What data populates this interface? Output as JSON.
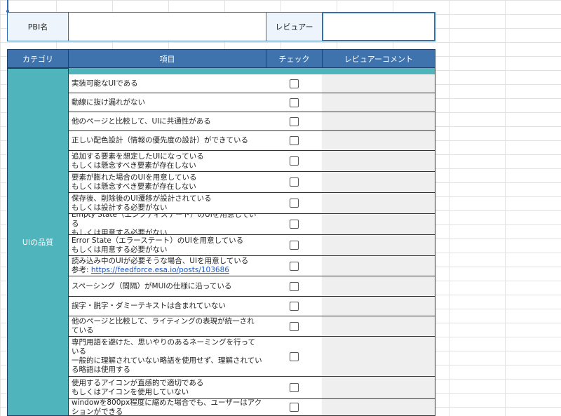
{
  "header": {
    "pbi_label": "PBI名",
    "pbi_value": "",
    "reviewer_label": "レビュアー",
    "reviewer_value": ""
  },
  "columns": {
    "category": "カテゴリ",
    "item": "項目",
    "check": "チェック",
    "comment": "レビュアーコメント"
  },
  "category_label": "UIの品質",
  "rows": [
    {
      "line1": "実装可能なUIである",
      "line2": ""
    },
    {
      "line1": "動線に抜け漏れがない",
      "line2": ""
    },
    {
      "line1": "他のページと比較して、UIに共通性がある",
      "line2": ""
    },
    {
      "line1": "正しい配色設計（情報の優先度の設計）ができている",
      "line2": ""
    },
    {
      "line1": "追加する要素を想定したUIになっている",
      "line2": "もしくは懸念すべき要素が存在しない"
    },
    {
      "line1": "要素が膨れた場合のUIを用意している",
      "line2": "もしくは懸念すべき要素が存在しない"
    },
    {
      "line1": "保存後、削除後のUI遷移が設計されている",
      "line2": "もしくは設計する必要がない"
    },
    {
      "line1": "Empty State（エンプティステート）のUIを用意している",
      "line2": "もしくは用意する必要がない"
    },
    {
      "line1": "Error State（エラーステート）のUIを用意している",
      "line2": "もしくは用意する必要がない"
    },
    {
      "line1": "読み込み中のUIが必要そうな場合、UIを用意している",
      "line2_prefix": "参考: ",
      "line2_link": "https://feedforce.esa.io/posts/103686"
    },
    {
      "line1": "スペーシング（間隔）がMUIの仕様に沿っている",
      "line2": ""
    },
    {
      "line1": "誤字・脱字・ダミーテキストは含まれていない",
      "line2": ""
    },
    {
      "line1": "他のページと比較して、ライティングの表現が統一され",
      "line2": "ている"
    },
    {
      "line1": "専門用語を避けた、思いやりのあるネーミングを行って",
      "line2": "いる",
      "line3": "一般的に理解されていない略語を使用せず、理解されてい",
      "line4": "る略語は使用する"
    },
    {
      "line1": "使用するアイコンが直感的で適切である",
      "line2": "もしくはアイコンを使用していない"
    },
    {
      "line1": "windowを800px程度に縮めた場合でも、ユーザーはアク",
      "line2": "ションができる"
    }
  ]
}
